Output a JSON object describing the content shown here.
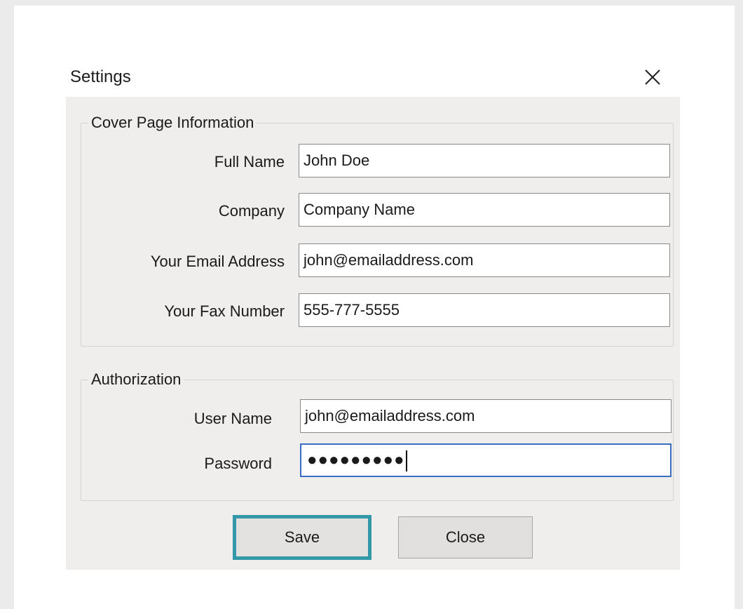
{
  "dialog": {
    "title": "Settings",
    "close_icon": "close-icon"
  },
  "cover_page": {
    "legend": "Cover Page Information",
    "fields": [
      {
        "label": "Full Name",
        "value": "John Doe"
      },
      {
        "label": "Company",
        "value": "Company Name"
      },
      {
        "label": "Your Email Address",
        "value": "john@emailaddress.com"
      },
      {
        "label": "Your Fax Number",
        "value": "555-777-5555"
      }
    ]
  },
  "authorization": {
    "legend": "Authorization",
    "user_name": {
      "label": "User Name",
      "value": "john@emailaddress.com"
    },
    "password": {
      "label": "Password",
      "value": "●●●●●●●●●"
    }
  },
  "buttons": {
    "save_label": "Save",
    "close_label": "Close"
  },
  "colors": {
    "focus_border": "#3a6ec2",
    "save_highlight": "#3398a8",
    "panel_background": "#f0eeec"
  }
}
